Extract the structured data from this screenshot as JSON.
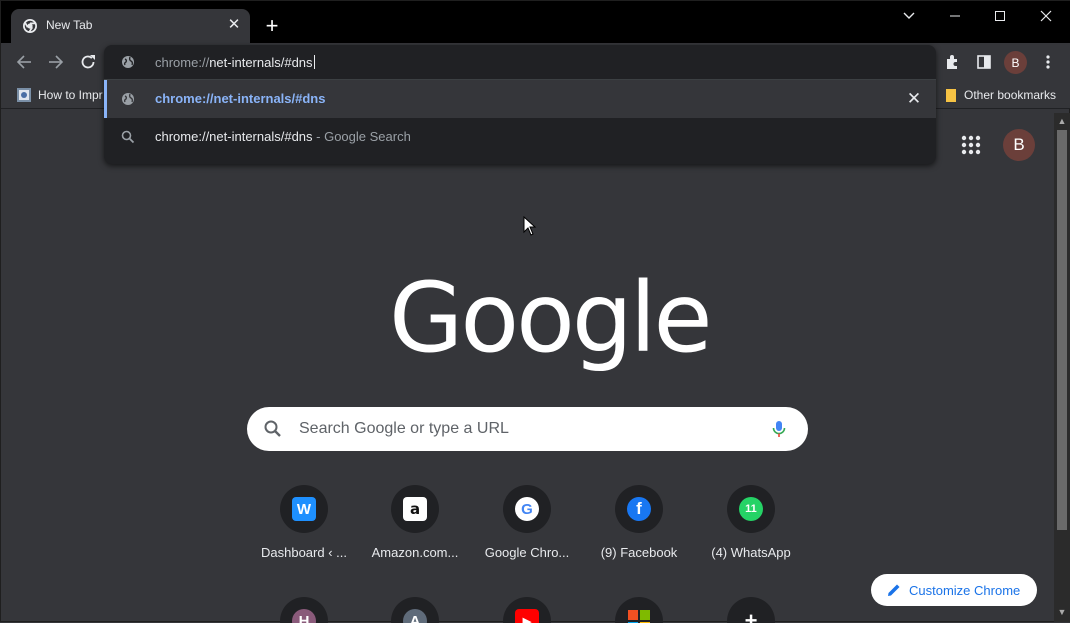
{
  "tab": {
    "title": "New Tab",
    "close": "✕"
  },
  "newtab": "+",
  "window_controls": {
    "dropdown": "⌄",
    "minimize": "—",
    "maximize": "☐",
    "close": "✕"
  },
  "omnibox": {
    "value_prefix": "chrome://",
    "value_host": "net-internals/#dns",
    "suggestions": [
      {
        "text": "chrome://net-internals/#dns",
        "remove": "✕",
        "icon": "globe-icon"
      },
      {
        "text": "chrome://net-internals/#dns",
        "sub": " - Google Search",
        "icon": "search-icon"
      }
    ]
  },
  "bookmarks": {
    "first": "How to Impr",
    "other": "Other bookmarks"
  },
  "profile": {
    "initial": "B"
  },
  "ntp": {
    "logo": "Google",
    "search_placeholder": "Search Google or type a URL",
    "tiles": [
      {
        "title": "Dashboard ‹ ...",
        "icon": "W",
        "color": "#1e90ff"
      },
      {
        "title": "Amazon.com...",
        "icon": "a",
        "color": "#ffffff"
      },
      {
        "title": "Google Chro...",
        "icon": "G",
        "color": "#ffffff"
      },
      {
        "title": "(9) Facebook",
        "icon": "f",
        "color": "#1877f2"
      },
      {
        "title": "(4) WhatsApp",
        "icon": "11",
        "color": "#25d366"
      }
    ],
    "second_row": [
      {
        "icon": "H",
        "color": "#8a5a7a"
      },
      {
        "icon": "A",
        "color": "#5f6b7a"
      },
      {
        "icon": "▶",
        "color": "#ff0000"
      },
      {
        "icon": "",
        "color": "#f25022"
      },
      {
        "icon": "+",
        "color": "#202124"
      }
    ],
    "customize_label": "Customize Chrome"
  },
  "colors": {
    "accent": "#8ab4f8",
    "background": "#35363a",
    "omnibox_bg": "#202124"
  }
}
